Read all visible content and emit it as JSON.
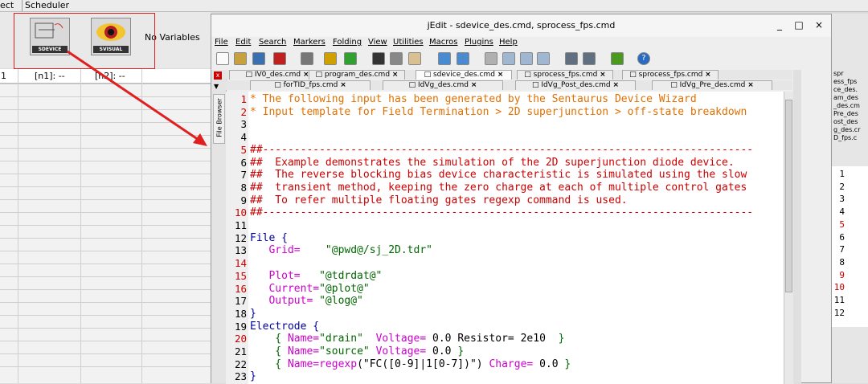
{
  "background": {
    "menubar": [
      "ect",
      "Scheduler"
    ],
    "tools": [
      {
        "label": "SDEVICE",
        "icon": "sdevice-icon"
      },
      {
        "label": "SVISUAL",
        "icon": "svisual-eye-icon"
      }
    ],
    "no_variables": "No Variables",
    "grid_row_label": "1",
    "node_cells": [
      "[n1]: --",
      "[n2]: --"
    ]
  },
  "window": {
    "title": "jEdit - sdevice_des.cmd, sprocess_fps.cmd",
    "controls": [
      "_",
      "□",
      "×"
    ],
    "menu": [
      "File",
      "Edit",
      "Search",
      "Markers",
      "Folding",
      "View",
      "Utilities",
      "Macros",
      "Plugins",
      "Help"
    ],
    "toolbar_icons": [
      "new-file-icon",
      "open-file-icon",
      "reload-icon",
      "close-file-icon",
      "print-icon",
      "undo-icon",
      "redo-icon",
      "cut-icon",
      "copy-icon",
      "paste-icon",
      "find-icon",
      "replace-icon",
      "new-view-icon",
      "split-horizontal-icon",
      "split-vertical-icon",
      "unsplit-icon",
      "buffer-options-icon",
      "global-options-icon",
      "plugin-manager-icon",
      "help-icon"
    ],
    "tabs_row1": [
      "IV0_des.cmd",
      "program_des.cmd",
      "sdevice_des.cmd",
      "sprocess_fps.cmd",
      "sprocess_fps.cmd"
    ],
    "tabs_row2": [
      "forTID_fps.cmd",
      "IdVg_des.cmd",
      "IdVg_Post_des.cmd",
      "IdVg_Pre_des.cmd"
    ],
    "active_tab": "sdevice_des.cmd",
    "file_browser": "File Browser"
  },
  "code": {
    "lines": [
      [
        {
          "t": "* The following input has been generated by the Sentaurus Device Wizard",
          "c": "#e07000"
        }
      ],
      [
        {
          "t": "* Input template for Field Termination > 2D superjunction > off-state breakdown",
          "c": "#e07000"
        }
      ],
      [
        {
          "t": "",
          "c": "#000"
        }
      ],
      [
        {
          "t": "",
          "c": "#000"
        }
      ],
      [
        {
          "t": "##------------------------------------------------------------------------------",
          "c": "#cc0000"
        }
      ],
      [
        {
          "t": "##  Example demonstrates the simulation of the 2D superjunction diode device.",
          "c": "#cc0000"
        }
      ],
      [
        {
          "t": "##  The reverse blocking bias device characteristic is simulated using the slow",
          "c": "#cc0000"
        }
      ],
      [
        {
          "t": "##  transient method, keeping the zero charge at each of multiple control gates",
          "c": "#cc0000"
        }
      ],
      [
        {
          "t": "##  To refer multiple floating gates regexp command is used.",
          "c": "#cc0000"
        }
      ],
      [
        {
          "t": "##------------------------------------------------------------------------------",
          "c": "#cc0000"
        }
      ],
      [
        {
          "t": "",
          "c": "#000"
        }
      ],
      [
        {
          "t": "File {",
          "c": "#000099"
        }
      ],
      [
        {
          "t": "   Grid=    ",
          "c": "#cc00cc"
        },
        {
          "t": "\"@pwd@/sj_2D.tdr\"",
          "c": "#006600"
        }
      ],
      [
        {
          "t": "",
          "c": "#000"
        }
      ],
      [
        {
          "t": "   Plot=   ",
          "c": "#cc00cc"
        },
        {
          "t": "\"@tdrdat@\"",
          "c": "#006600"
        }
      ],
      [
        {
          "t": "   Current=",
          "c": "#cc00cc"
        },
        {
          "t": "\"@plot@\"",
          "c": "#006600"
        }
      ],
      [
        {
          "t": "   Output= ",
          "c": "#cc00cc"
        },
        {
          "t": "\"@log@\"",
          "c": "#006600"
        }
      ],
      [
        {
          "t": "}",
          "c": "#000099"
        }
      ],
      [
        {
          "t": "Electrode {",
          "c": "#000099"
        }
      ],
      [
        {
          "t": "    { ",
          "c": "#006600"
        },
        {
          "t": "Name=",
          "c": "#cc00cc"
        },
        {
          "t": "\"drain\"  ",
          "c": "#006600"
        },
        {
          "t": "Voltage=",
          "c": "#cc00cc"
        },
        {
          "t": " 0.0 Resistor= 2e10  ",
          "c": "#000"
        },
        {
          "t": "}",
          "c": "#006600"
        }
      ],
      [
        {
          "t": "    { ",
          "c": "#006600"
        },
        {
          "t": "Name=",
          "c": "#cc00cc"
        },
        {
          "t": "\"source\" ",
          "c": "#006600"
        },
        {
          "t": "Voltage=",
          "c": "#cc00cc"
        },
        {
          "t": " 0.0 ",
          "c": "#000"
        },
        {
          "t": "}",
          "c": "#006600"
        }
      ],
      [
        {
          "t": "    { ",
          "c": "#006600"
        },
        {
          "t": "Name=",
          "c": "#cc00cc"
        },
        {
          "t": "regexp",
          "c": "#cc00cc"
        },
        {
          "t": "(\"FC([0-9]|1[0-7])\") ",
          "c": "#000"
        },
        {
          "t": "Charge=",
          "c": "#cc00cc"
        },
        {
          "t": " 0.0 ",
          "c": "#000"
        },
        {
          "t": "}",
          "c": "#006600"
        }
      ],
      [
        {
          "t": "}",
          "c": "#000099"
        }
      ]
    ],
    "red_line_numbers": [
      1,
      2,
      5,
      10,
      14,
      15,
      16,
      20
    ]
  },
  "right_pane": {
    "tabs": [
      "spr",
      "ess_fps",
      "ce_des.",
      "am_des",
      "_des.cm",
      "Pre_des",
      "ost_des",
      "g_des.cr",
      "D_fps.c"
    ],
    "line_numbers": [
      "1",
      "2",
      "3",
      "4",
      "5",
      "6",
      "7",
      "8",
      "9",
      "10",
      "11",
      "12"
    ]
  },
  "annotation": {
    "color": "#e02020"
  }
}
